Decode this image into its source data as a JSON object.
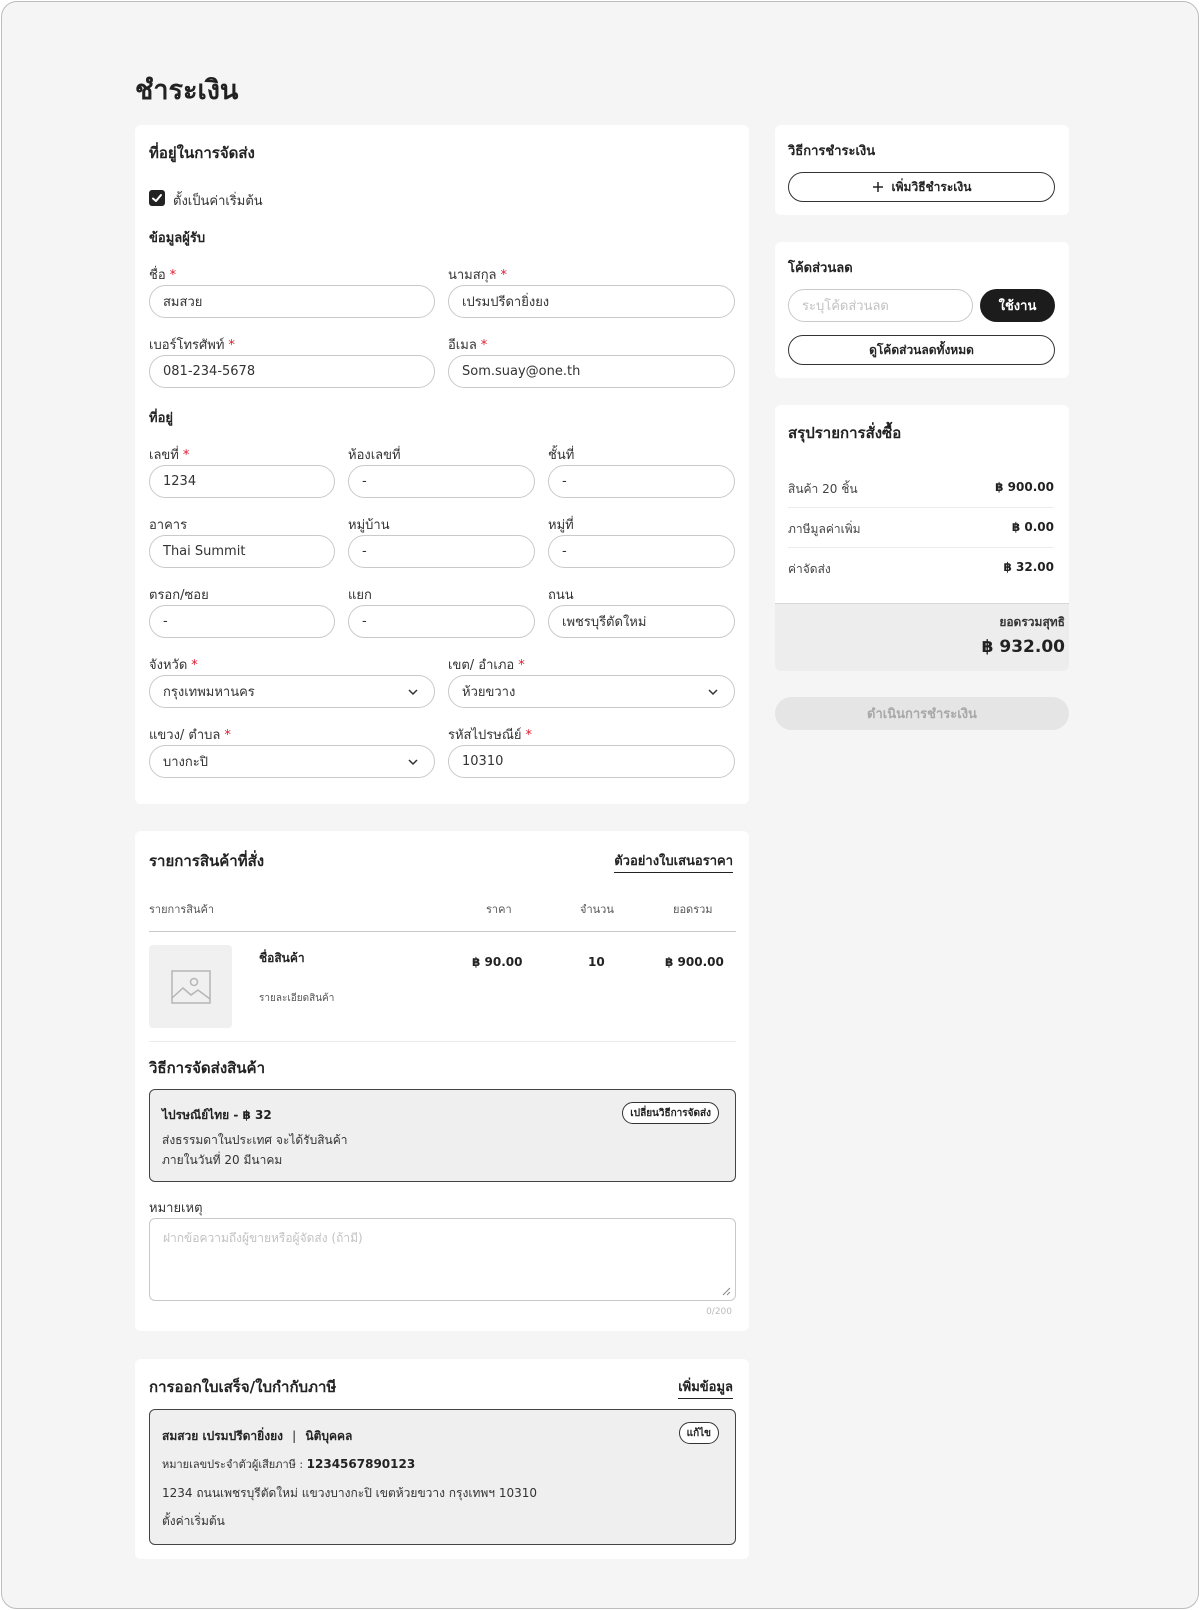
{
  "page": {
    "title": "ชำระเงิน"
  },
  "shipping": {
    "title": "ที่อยู่ในการจัดส่ง",
    "default_label": "ตั้งเป็นค่าเริ่มต้น",
    "default_checked": true,
    "recipient_title": "ข้อมูลผู้รับ",
    "first_name": {
      "label": "ชื่อ",
      "value": "สมสวย"
    },
    "last_name": {
      "label": "นามสกุล",
      "value": "เปรมปรีดายิ่งยง"
    },
    "phone": {
      "label": "เบอร์โทรศัพท์",
      "value": "081-234-5678"
    },
    "email": {
      "label": "อีเมล",
      "value": "Som.suay@one.th"
    },
    "address_title": "ที่อยู่",
    "house_no": {
      "label": "เลขที่",
      "value": "1234"
    },
    "room_no": {
      "label": "ห้องเลขที่",
      "value": "-"
    },
    "floor": {
      "label": "ชั้นที่",
      "value": "-"
    },
    "building": {
      "label": "อาคาร",
      "value": "Thai Summit"
    },
    "village": {
      "label": "หมู่บ้าน",
      "value": "-"
    },
    "moo": {
      "label": "หมู่ที่",
      "value": "-"
    },
    "soi": {
      "label": "ตรอก/ซอย",
      "value": "-"
    },
    "yaek": {
      "label": "แยก",
      "value": "-"
    },
    "road": {
      "label": "ถนน",
      "value": "เพชรบุรีตัดใหม่"
    },
    "province": {
      "label": "จังหวัด",
      "value": "กรุงเทพมหานคร"
    },
    "district": {
      "label": "เขต/ อำเภอ",
      "value": "ห้วยขวาง"
    },
    "subdistrict": {
      "label": "แขวง/ ตำบล",
      "value": "บางกะปิ"
    },
    "postcode": {
      "label": "รหัสไปรษณีย์",
      "value": "10310"
    }
  },
  "payment": {
    "title": "วิธีการชำระเงิน",
    "add_label": "เพิ่มวิธีชำระเงิน"
  },
  "discount": {
    "title": "โค้ดส่วนลด",
    "placeholder": "ระบุโค้ดส่วนลด",
    "apply_label": "ใช้งาน",
    "view_all_label": "ดูโค้ดส่วนลดทั้งหมด"
  },
  "summary": {
    "title": "สรุปรายการสั่งซื้อ",
    "rows": [
      {
        "label": "สินค้า 20 ชิ้น",
        "value": "฿ 900.00"
      },
      {
        "label": "ภาษีมูลค่าเพิ่ม",
        "value": "฿ 0.00"
      },
      {
        "label": "ค่าจัดส่ง",
        "value": "฿ 32.00"
      }
    ],
    "total_label": "ยอดรวมสุทธิ",
    "total_value": "฿ 932.00"
  },
  "checkout_label": "ดำเนินการชำระเงิน",
  "order": {
    "title": "รายการสินค้าที่สั่ง",
    "quote_link": "ตัวอย่างใบเสนอราคา",
    "columns": {
      "product": "รายการสินค้า",
      "price": "ราคา",
      "qty": "จำนวน",
      "total": "ยอดรวม"
    },
    "item": {
      "name": "ชื่อสินค้า",
      "detail": "รายละเอียดสินค้า",
      "price": "฿ 90.00",
      "qty": "10",
      "total": "฿ 900.00"
    },
    "delivery_title": "วิธีการจัดส่งสินค้า",
    "delivery": {
      "name": "ไปรษณีย์ไทย - ฿ 32",
      "change_label": "เปลี่ยนวิธีการจัดส่ง",
      "line1": "ส่งธรรมดาในประเทศ จะได้รับสินค้า",
      "line2": "ภายในวันที่ 20 มีนาคม"
    },
    "note_label": "หมายเหตุ",
    "note_placeholder": "ฝากข้อความถึงผู้ขายหรือผู้จัดส่ง (ถ้ามี)",
    "note_counter": "0/200"
  },
  "invoice": {
    "title": "การออกใบเสร็จ/ใบกำกับภาษี",
    "add_link": "เพิ่มข้อมูล",
    "name": "สมสวย เปรมปรีดายิ่งยง",
    "type": "นิติบุคคล",
    "edit_label": "แก้ไข",
    "tax_label": "หมายเลขประจำตัวผู้เสียภาษี :",
    "tax_id": "1234567890123",
    "address": "1234 ถนนเพชรบุรีตัดใหม่ แขวงบางกะปิ เขตห้วยขวาง กรุงเทพฯ 10310",
    "default_text": "ตั้งค่าเริ่มต้น"
  }
}
